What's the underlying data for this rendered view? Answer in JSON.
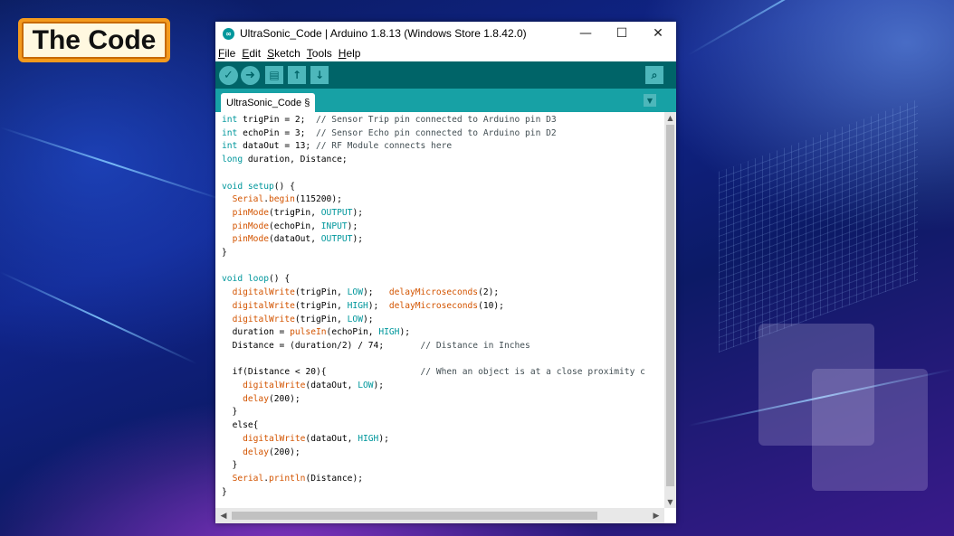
{
  "badge": {
    "label": "The Code"
  },
  "window": {
    "title": "UltraSonic_Code | Arduino 1.8.13 (Windows Store 1.8.42.0)",
    "controls": {
      "minimize": "—",
      "maximize": "☐",
      "close": "✕"
    }
  },
  "menu": [
    "File",
    "Edit",
    "Sketch",
    "Tools",
    "Help"
  ],
  "toolbar": {
    "verify_icon": "check-icon",
    "upload_icon": "arrow-right-icon",
    "new_icon": "new-file-icon",
    "open_icon": "arrow-up-icon",
    "save_icon": "arrow-down-icon",
    "serial_icon": "magnifier-icon"
  },
  "tab": {
    "label": "UltraSonic_Code §"
  },
  "code_lines": [
    "int trigPin = 2;  // Sensor Trip pin connected to Arduino pin D3",
    "int echoPin = 3;  // Sensor Echo pin connected to Arduino pin D2",
    "int dataOut = 13; // RF Module connects here",
    "long duration, Distance;",
    "",
    "void setup() {",
    "  Serial.begin(115200);",
    "  pinMode(trigPin, OUTPUT);",
    "  pinMode(echoPin, INPUT);",
    "  pinMode(dataOut, OUTPUT);",
    "}",
    "",
    "void loop() {",
    "  digitalWrite(trigPin, LOW);   delayMicroseconds(2);",
    "  digitalWrite(trigPin, HIGH);  delayMicroseconds(10);",
    "  digitalWrite(trigPin, LOW);",
    "  duration = pulseIn(echoPin, HIGH);",
    "  Distance = (duration/2) / 74;       // Distance in Inches",
    "",
    "  if(Distance < 20){                  // When an object is at a close proximity c",
    "    digitalWrite(dataOut, LOW);",
    "    delay(200);",
    "  }",
    "  else{",
    "    digitalWrite(dataOut, HIGH);",
    "    delay(200);",
    "  }",
    "  Serial.println(Distance);",
    "}"
  ],
  "colors": {
    "toolbar": "#006468",
    "tabbar": "#17a1a5",
    "keyword": "#00979c",
    "function": "#d35400",
    "badge_border": "#f39a1e"
  }
}
